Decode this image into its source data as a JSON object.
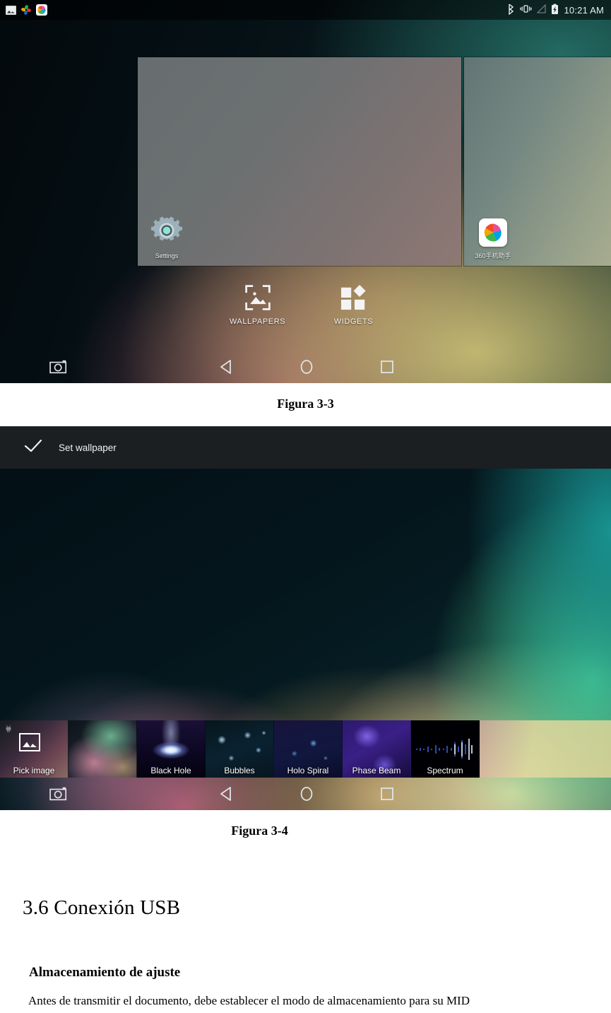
{
  "page": {
    "document_language": "es"
  },
  "screenshot_one": {
    "statusbar": {
      "notification_icons": [
        "screenshot-icon",
        "pinwheel-icon",
        "app-360-icon"
      ],
      "system_icons": [
        "bluetooth-icon",
        "vibrate-icon",
        "signal-icon",
        "battery-charging-icon"
      ],
      "clock": "10:21 AM"
    },
    "panes": {
      "main_pane_icon_label": "Settings",
      "next_pane_icon_label": "360手机助手"
    },
    "actions": [
      {
        "label": "WALLPAPERS",
        "icon": "wallpaper-picture-icon"
      },
      {
        "label": "WIDGETS",
        "icon": "widgets-grid-icon"
      }
    ],
    "navbar": [
      {
        "name": "screenshot",
        "icon": "camera-icon"
      },
      {
        "name": "back",
        "icon": "back-triangle-icon"
      },
      {
        "name": "home",
        "icon": "home-circle-icon"
      },
      {
        "name": "recents",
        "icon": "recents-square-icon"
      }
    ]
  },
  "caption_one": "Figura 3-3",
  "screenshot_two": {
    "action_bar": {
      "confirm_label": "Set wallpaper",
      "confirm_icon": "check-icon"
    },
    "thumbnails": [
      {
        "label": "Pick image",
        "art": "pick"
      },
      {
        "label": "",
        "art": "gradient"
      },
      {
        "label": "Black Hole",
        "art": "blackhole"
      },
      {
        "label": "Bubbles",
        "art": "bubbles"
      },
      {
        "label": "Holo Spiral",
        "art": "holospiral"
      },
      {
        "label": "Phase Beam",
        "art": "phasebeam"
      },
      {
        "label": "Spectrum",
        "art": "spectrum"
      }
    ],
    "navbar": [
      {
        "name": "screenshot",
        "icon": "camera-icon"
      },
      {
        "name": "back",
        "icon": "back-triangle-icon"
      },
      {
        "name": "home",
        "icon": "home-circle-icon"
      },
      {
        "name": "recents",
        "icon": "recents-square-icon"
      }
    ]
  },
  "caption_two": "Figura 3-4",
  "document": {
    "section_heading": "3.6 Conexión USB",
    "subheading": "Almacenamiento de ajuste",
    "paragraph": "Antes de transmitir el documento, debe establecer el modo de almacenamiento para su MID"
  },
  "colors": {
    "accent_teal": "#1e9e96",
    "statusbar_text": "#e8eef0",
    "setwall_bar_bg": "#1b1f21",
    "document_text": "#000000"
  }
}
